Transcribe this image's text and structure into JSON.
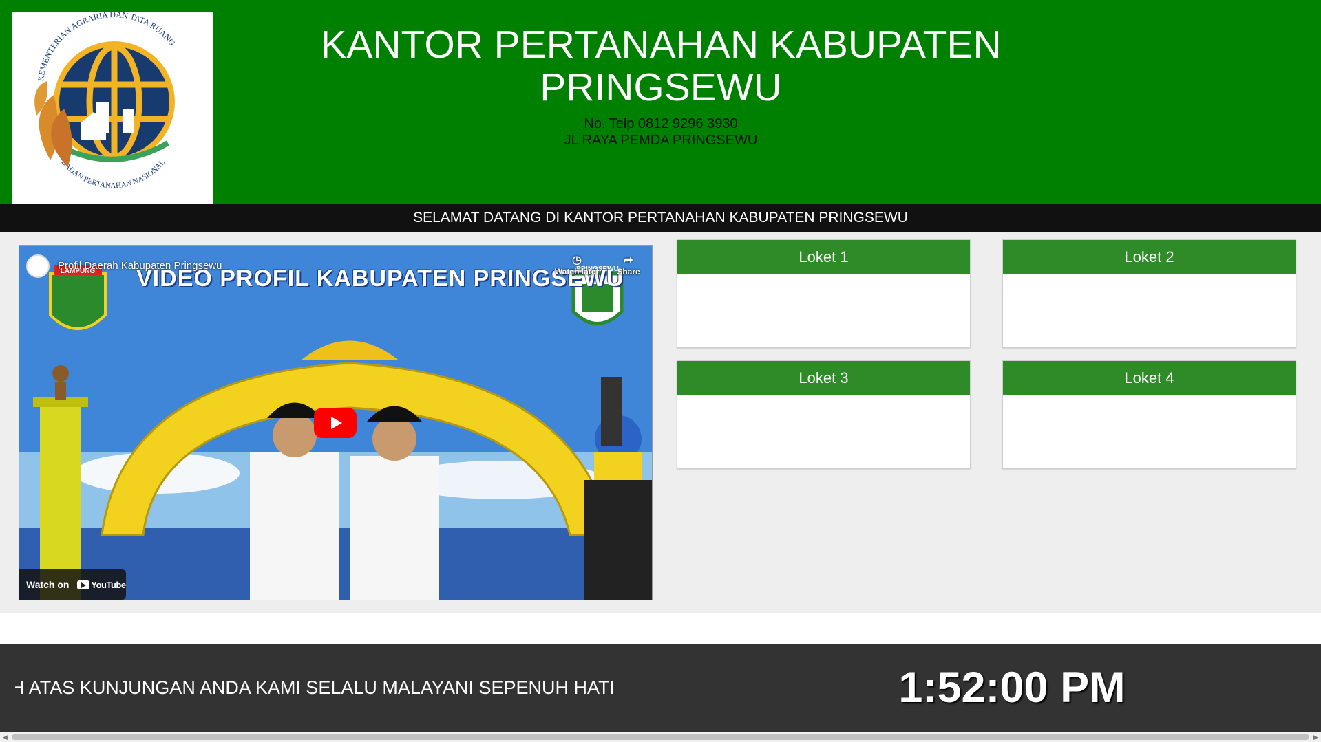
{
  "header": {
    "title": "KANTOR PERTANAHAN KABUPATEN PRINGSEWU",
    "phone": "No. Telp 0812 9296 3930",
    "address": "JL RAYA PEMDA PRINGSEWU",
    "logo_text_top": "KEMENTERIAN AGRARIA DAN TATA RUANG",
    "logo_text_bottom": "BADAN PERTANAHAN NASIONAL"
  },
  "welcome": "SELAMAT DATANG DI KANTOR PERTANAHAN KABUPATEN PRINGSEWU",
  "video": {
    "title": "Profil Daerah Kabupaten Pringsewu",
    "heading": "VIDEO PROFIL KABUPATEN PRINGSEWU",
    "watch_later": "Watch later",
    "share": "Share",
    "watch_on": "Watch on",
    "youtube": "YouTube",
    "badge_left": "LAMPUNG",
    "badge_right": "PRINGSEWU"
  },
  "lokets": [
    {
      "label": "Loket 1"
    },
    {
      "label": "Loket 2"
    },
    {
      "label": "Loket 3"
    },
    {
      "label": "Loket 4"
    }
  ],
  "footer": {
    "marquee": "H ATAS KUNJUNGAN ANDA KAMI SELALU MALAYANI SEPENUH HATI",
    "clock": "1:52:00 PM"
  },
  "colors": {
    "header_green": "#008000",
    "loket_green": "#2e8b27",
    "footer_dark": "#333333",
    "welcome_bar": "#111111"
  }
}
